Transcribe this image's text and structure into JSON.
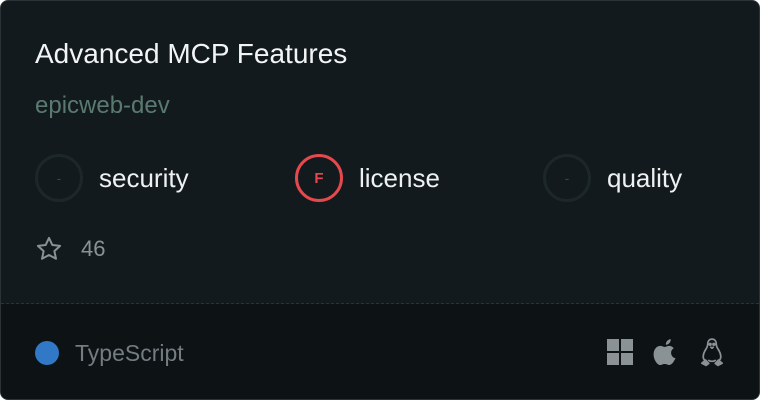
{
  "card": {
    "title": "Advanced MCP Features",
    "owner": "epicweb-dev",
    "scores": [
      {
        "grade": "-",
        "label": "security",
        "status": "none"
      },
      {
        "grade": "F",
        "label": "license",
        "status": "fail"
      },
      {
        "grade": "-",
        "label": "quality",
        "status": "none"
      }
    ],
    "stars": {
      "icon": "star-outline-icon",
      "count": "46"
    },
    "language": {
      "name": "TypeScript",
      "color": "#3178c6"
    },
    "platforms": [
      {
        "name": "windows",
        "icon": "windows-icon"
      },
      {
        "name": "macos",
        "icon": "apple-icon"
      },
      {
        "name": "linux",
        "icon": "linux-icon"
      }
    ]
  },
  "colors": {
    "card_background": "#121a1d",
    "footer_background": "#0d1215",
    "fail_red": "#e5484d",
    "owner_text": "#5a7a70",
    "icon_gray": "#8a9296"
  }
}
